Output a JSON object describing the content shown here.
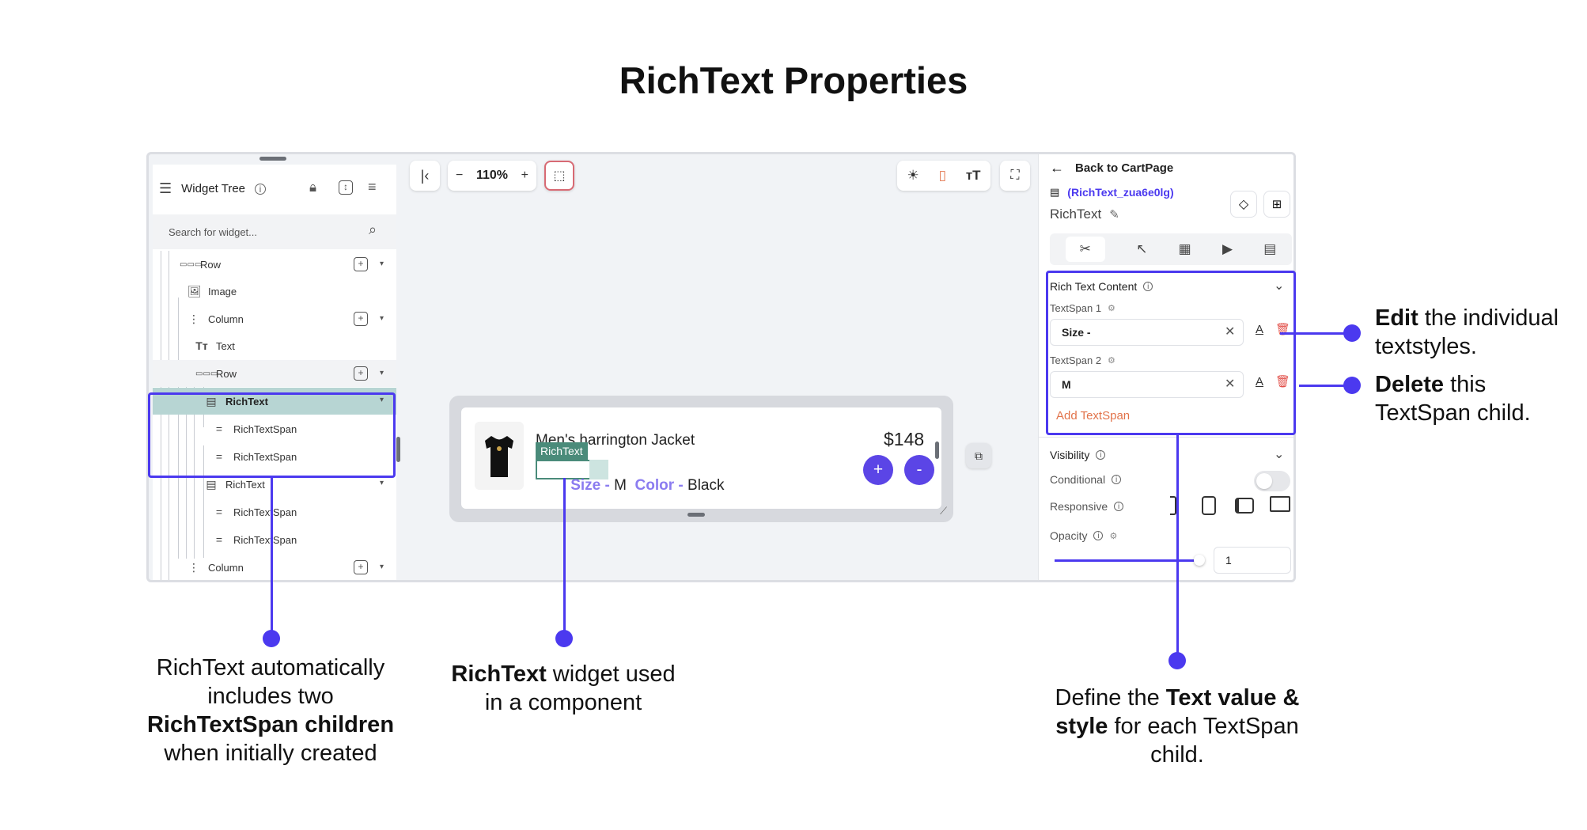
{
  "title": "RichText Properties",
  "widget_tree": {
    "header": "Widget Tree",
    "search_placeholder": "Search for widget...",
    "items": [
      {
        "label": "Row"
      },
      {
        "label": "Image"
      },
      {
        "label": "Column"
      },
      {
        "label": "Text"
      },
      {
        "label": "Row"
      },
      {
        "label": "RichText"
      },
      {
        "label": "RichTextSpan"
      },
      {
        "label": "RichTextSpan"
      },
      {
        "label": "RichText"
      },
      {
        "label": "RichTextSpan"
      },
      {
        "label": "RichTextSpan"
      },
      {
        "label": "Column"
      }
    ]
  },
  "canvas": {
    "zoom": "110%",
    "zoom_minus": "−",
    "zoom_plus": "+",
    "product_name": "Men's harrington Jacket",
    "price": "$148",
    "richtext_tag": "RichText",
    "span_size_label": "Size - ",
    "span_size_value": "M",
    "span_color_label": "Color - ",
    "span_color_value": "Black",
    "plus_label": "+",
    "minus_label": "-"
  },
  "properties": {
    "back_label": "Back to CartPage",
    "widget_id": "(RichText_zua6e0lg)",
    "widget_type": "RichText",
    "section_title": "Rich Text Content",
    "span1_label": "TextSpan 1",
    "span1_value": "Size -",
    "span2_label": "TextSpan 2",
    "span2_value": "M",
    "add_span": "Add TextSpan",
    "visibility": "Visibility",
    "conditional": "Conditional",
    "responsive": "Responsive",
    "opacity": "Opacity",
    "opacity_value": "1"
  },
  "annotations": {
    "edit_bold": "Edit",
    "edit_rest": " the individual",
    "edit_line2": "textstyles.",
    "delete_bold": "Delete",
    "delete_rest": " this",
    "delete_line2": "TextSpan child.",
    "tree_line1": "RichText automatically",
    "tree_line2": "includes two",
    "tree_line3": "RichTextSpan children",
    "tree_line4": "when initially created",
    "widget_bold": "RichText",
    "widget_rest": " widget used",
    "widget_line2": "in a component",
    "define_pre": "Define the ",
    "define_bold": "Text value &",
    "define_bold2": "style",
    "define_rest": " for each TextSpan",
    "define_line3": "child."
  },
  "colors": {
    "accent": "#4b39ef",
    "highlight_row": "#b7d5d3",
    "tag_green": "#4a8b7a",
    "delete_red": "#e2504a",
    "add_orange": "#e2734a"
  }
}
